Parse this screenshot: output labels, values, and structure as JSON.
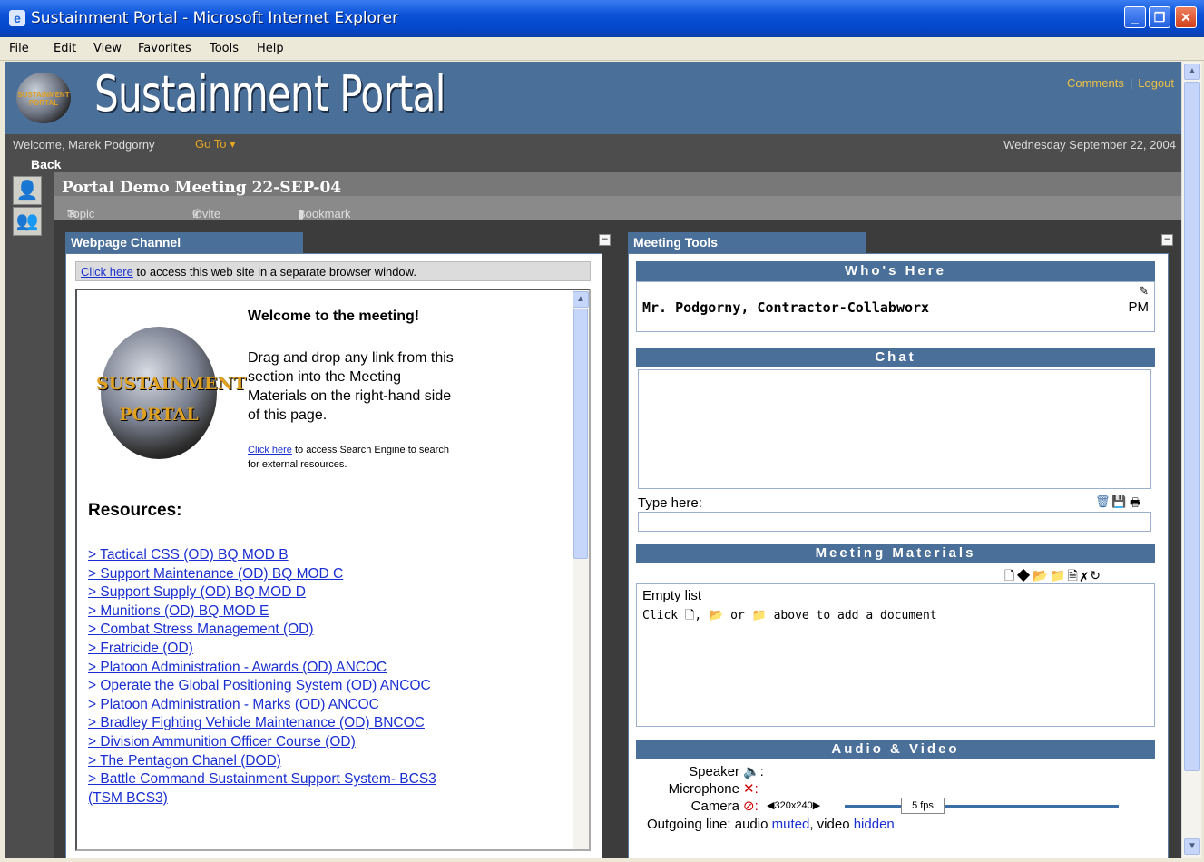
{
  "window": {
    "title": "Sustainment Portal - Microsoft Internet Explorer",
    "app_icon": "ie-icon"
  },
  "menu": [
    "File",
    "Edit",
    "View",
    "Favorites",
    "Tools",
    "Help"
  ],
  "banner": {
    "brand": "Sustainment Portal",
    "logo_text": "SUSTAINMENT PORTAL",
    "links": {
      "comments": "Comments",
      "logout": "Logout"
    }
  },
  "welcome": {
    "text": "Welcome, Marek Podgorny",
    "goto": "Go To",
    "date": "Wednesday September 22, 2004"
  },
  "back_home": "Back Home",
  "meeting": {
    "title": "Portal Demo Meeting 22-SEP-04",
    "actions": [
      "Topic Feedback",
      "Invite Users",
      "Bookmark Meeting"
    ]
  },
  "webpage_channel": {
    "tab": "Webpage Channel",
    "click_here": "Click here",
    "linkbar_rest": " to access this web site in a separate browser window.",
    "logo_line1": "SUSTAINMENT",
    "logo_line2": "PORTAL",
    "welcome_heading": "Welcome to the meeting!",
    "drag_text": "Drag and drop any link from this section into the Meeting Materials on the right-hand side of this page.",
    "search_link": "Click here",
    "search_rest": " to access Search Engine to search for external resources.",
    "resources_heading": "Resources:",
    "resources": [
      "> Tactical CSS (OD) BQ MOD B",
      "> Support Maintenance (OD) BQ MOD C",
      "> Support Supply (OD) BQ MOD D",
      "> Munitions (OD) BQ MOD E",
      "> Combat Stress Management (OD)",
      "> Fratricide (OD)",
      "> Platoon Administration - Awards (OD) ANCOC",
      "> Operate the Global Positioning System (OD) ANCOC",
      "> Platoon Administration - Marks (OD) ANCOC",
      "> Bradley Fighting Vehicle Maintenance (OD) BNCOC",
      "> Division Ammunition Officer Course (OD)",
      "> The Pentagon Chanel (DOD)",
      "> Battle Command Sustainment Support System- BCS3 (TSM BCS3)"
    ]
  },
  "meeting_tools": {
    "tab": "Meeting Tools",
    "whos_here": {
      "heading": "Who's Here",
      "user": "Mr. Podgorny, Contractor-Collabworx",
      "time": "PM"
    },
    "chat": {
      "heading": "Chat",
      "type_label": "Type here:",
      "input_value": ""
    },
    "materials": {
      "heading": "Meeting Materials",
      "empty": "Empty list",
      "click": "Click",
      "sep1": ",",
      "or": "or",
      "tail": "above to add a document"
    },
    "av": {
      "heading": "Audio & Video",
      "speaker": "Speaker",
      "microphone": "Microphone",
      "camera": "Camera",
      "resolution": "320x240",
      "fps": "5 fps",
      "outgoing_label": "Outgoing line:",
      "audio_word": "audio",
      "audio_state": "muted",
      "video_word": "video",
      "video_state": "hidden"
    }
  }
}
